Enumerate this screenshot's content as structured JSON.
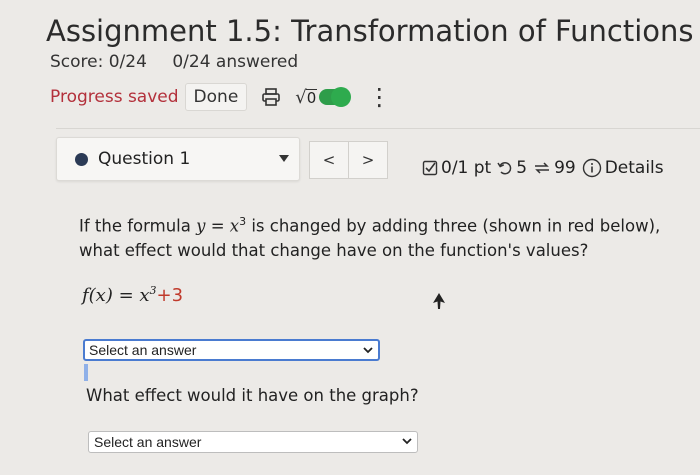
{
  "header": {
    "title": "Assignment 1.5: Transformation of Functions",
    "score": "Score: 0/24",
    "answered": "0/24 answered",
    "progress_saved": "Progress saved",
    "done_label": "Done",
    "sqrt_label": "0"
  },
  "toolbar_icons": [
    "printer-icon",
    "sqrt-icon",
    "toggle",
    "kebab-menu-icon"
  ],
  "question_nav": {
    "question_label": "Question 1",
    "prev_label": "<",
    "next_label": ">",
    "points": "0/1 pt",
    "attempts": "5",
    "retries": "99",
    "details_label": "Details"
  },
  "question": {
    "text_before": "If the formula ",
    "var_y": "y",
    "equals": " = ",
    "var_x": "x",
    "exp": "3",
    "text_after": " is changed by adding three (shown in red below), what effect would that change have on the function's values?",
    "formula_lhs": "f(x) = ",
    "formula_x": "x",
    "formula_exp": "3",
    "formula_added": "+3",
    "select1_value": "Select an answer",
    "question2": "What effect would it have on the graph?",
    "select2_value": "Select an answer"
  },
  "colors": {
    "progress_saved": "#b3303b",
    "toggle_on": "#2e9d4a",
    "formula_added": "#c0392b",
    "select_focus_border": "#4a7bd0"
  }
}
